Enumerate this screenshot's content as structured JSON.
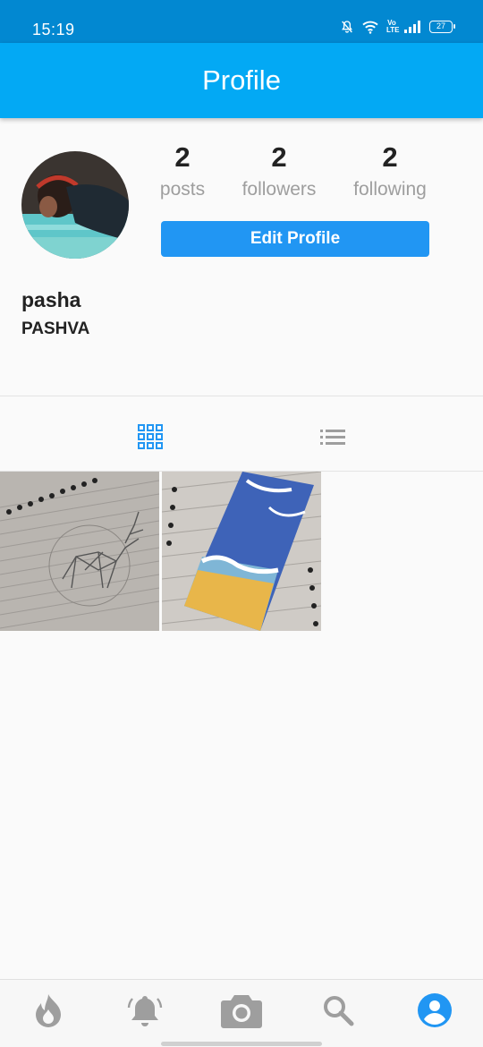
{
  "status_bar": {
    "time": "15:19",
    "icons": [
      "mute-notifications-icon",
      "wifi-icon",
      "volte-icon",
      "signal-icon",
      "battery-icon"
    ],
    "volte_text": "Vo LTE",
    "battery": "27"
  },
  "app_bar": {
    "title": "Profile"
  },
  "profile": {
    "stats": [
      {
        "value": "2",
        "label": "posts"
      },
      {
        "value": "2",
        "label": "followers"
      },
      {
        "value": "2",
        "label": "following"
      }
    ],
    "edit_button_label": "Edit Profile",
    "username": "pasha",
    "display_name": "PASHVA"
  },
  "tabs": [
    {
      "icon": "grid-icon",
      "active": true
    },
    {
      "icon": "list-icon",
      "active": false
    }
  ],
  "posts": [
    {
      "description": "pencil-sketch-deer"
    },
    {
      "description": "painted-beach-bookmark"
    }
  ],
  "bottom_nav": [
    {
      "icon": "flame-icon",
      "active": false
    },
    {
      "icon": "notifications-icon",
      "active": false
    },
    {
      "icon": "camera-icon",
      "active": false
    },
    {
      "icon": "search-icon",
      "active": false
    },
    {
      "icon": "account-icon",
      "active": true
    }
  ],
  "colors": {
    "status_bar": "#0288d1",
    "app_bar": "#03a9f4",
    "button": "#2196f3",
    "active_icon": "#2196f3",
    "inactive_icon": "#9e9e9e",
    "background": "#fafafa"
  }
}
